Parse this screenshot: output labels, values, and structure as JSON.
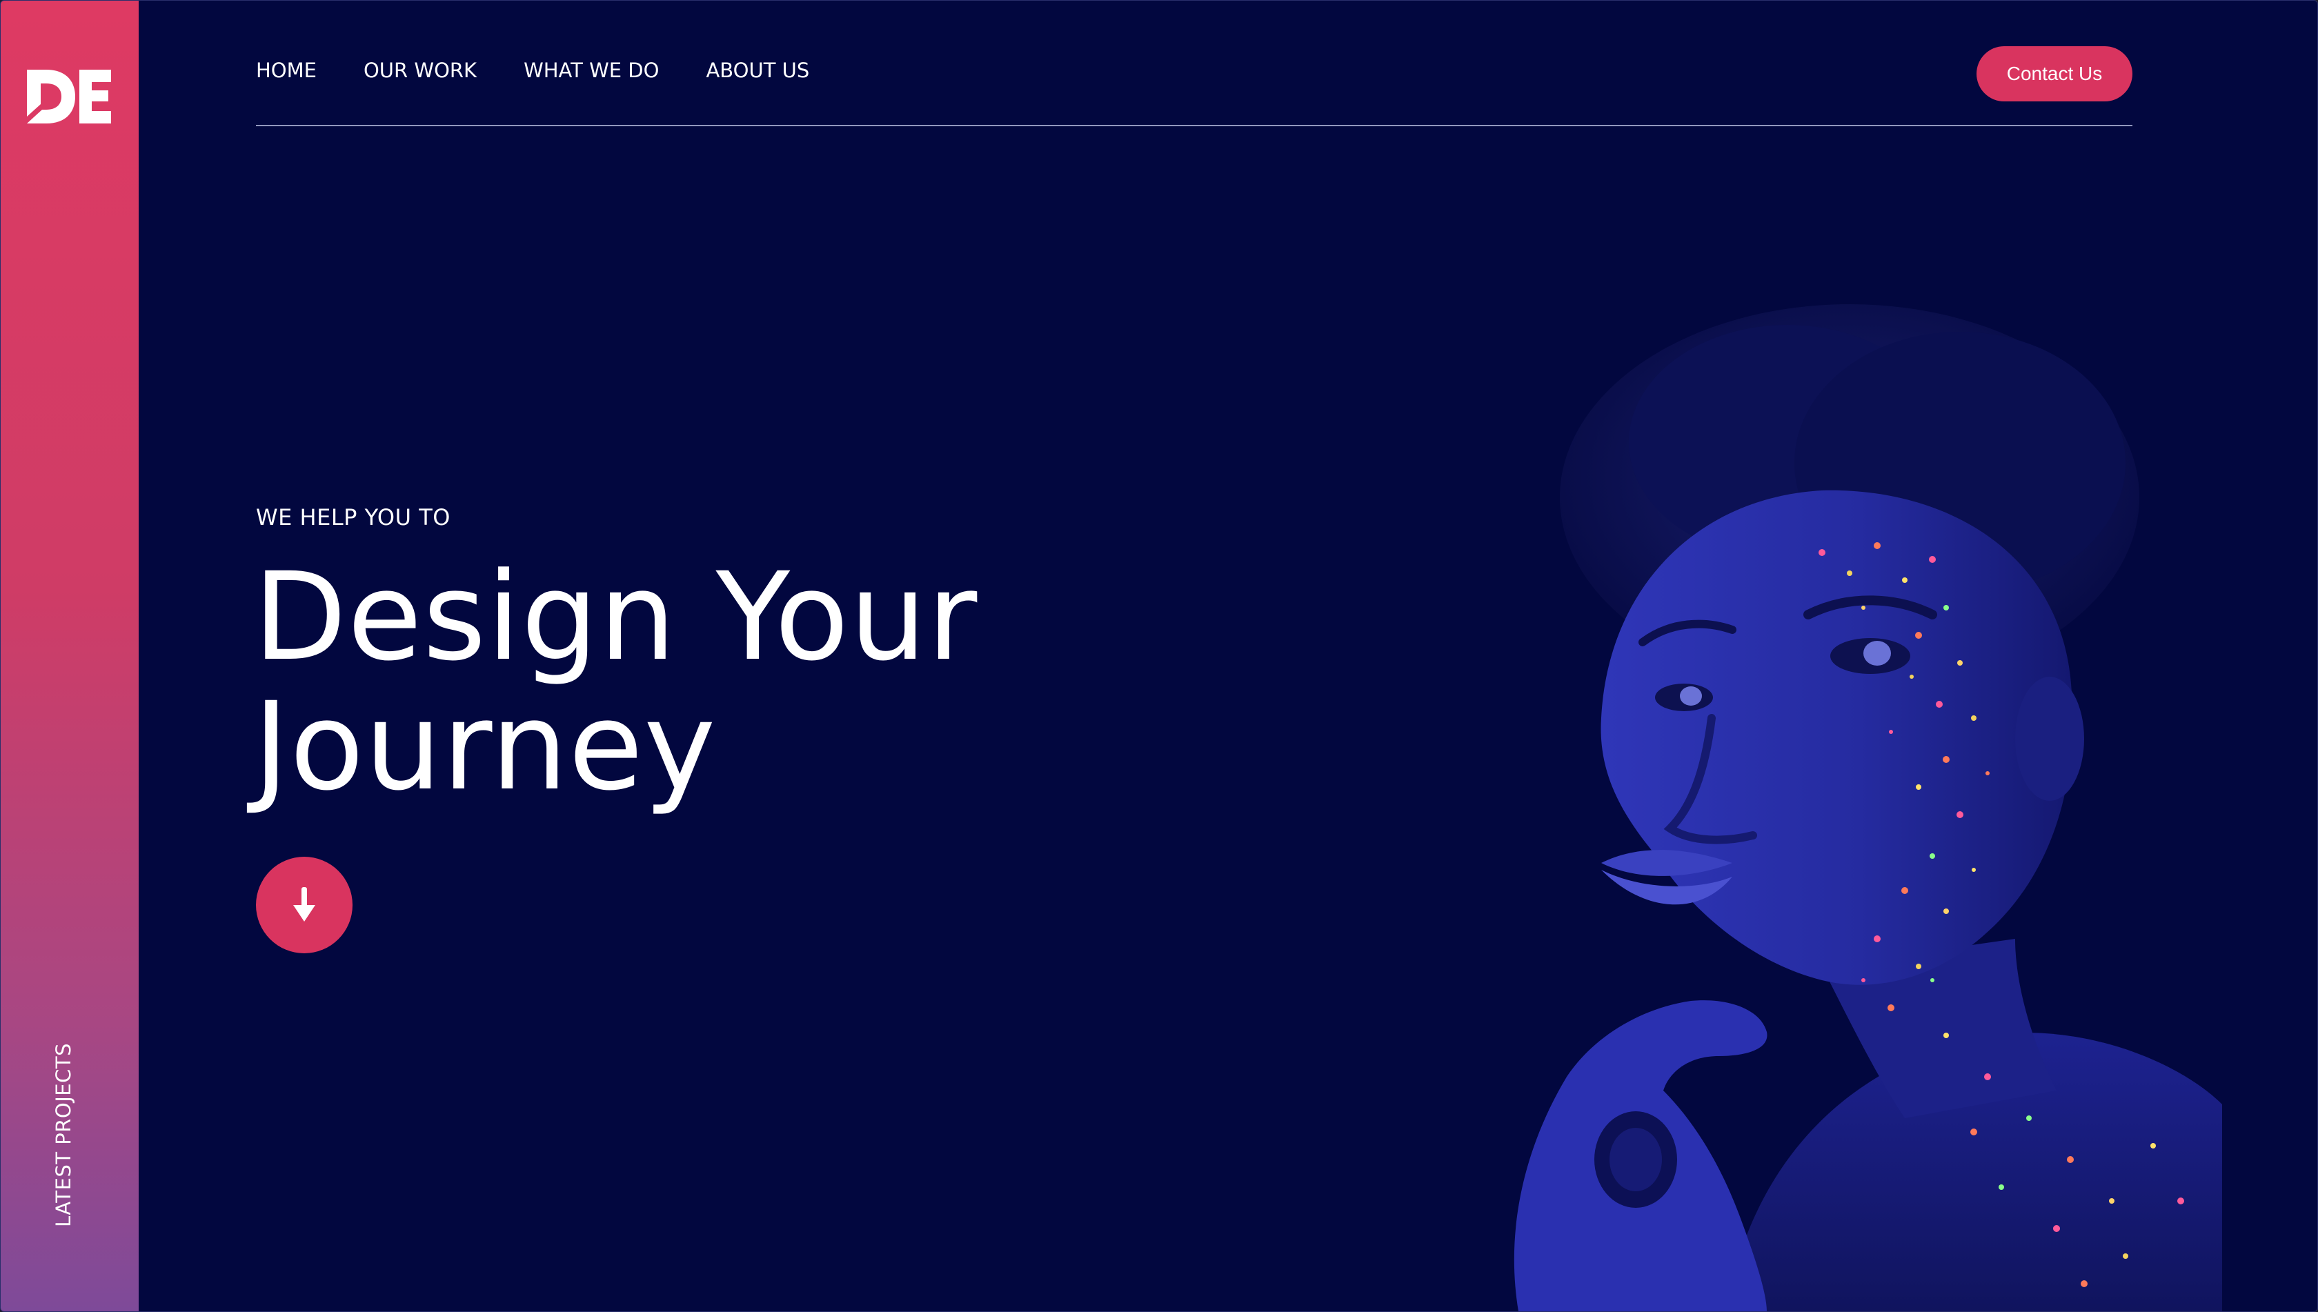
{
  "brand": {
    "logo_text": "DE",
    "accent_color": "#d9345f",
    "background_color": "#02073f"
  },
  "nav": {
    "items": [
      {
        "label": "HOME"
      },
      {
        "label": "OUR WORK"
      },
      {
        "label": "WHAT WE DO"
      },
      {
        "label": "ABOUT US"
      }
    ],
    "contact_label": "Contact Us"
  },
  "sidebar": {
    "vertical_label": "LATEST PROJECTS"
  },
  "hero": {
    "eyebrow": "WE HELP YOU TO",
    "headline_line1": "Design Your",
    "headline_line2": "Journey",
    "scroll_icon": "arrow-down-icon"
  }
}
